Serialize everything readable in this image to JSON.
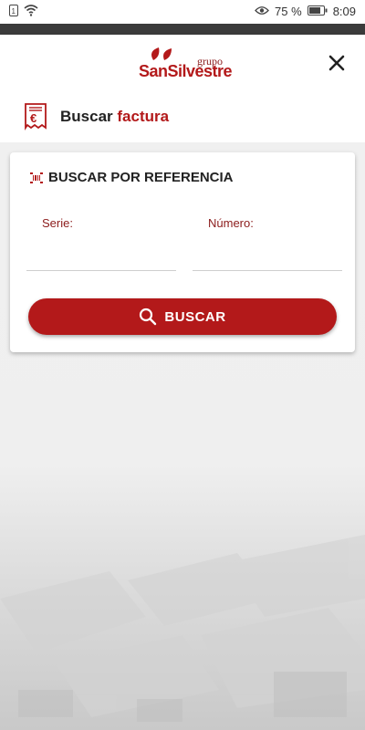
{
  "status_bar": {
    "battery_percent": "75 %",
    "time": "8:09"
  },
  "header": {
    "logo_small": "grupo",
    "logo_brand": "SanSilvestre"
  },
  "title": {
    "prefix": "Buscar",
    "accent": "factura"
  },
  "card": {
    "heading": "BUSCAR POR REFERENCIA",
    "serie_label": "Serie:",
    "numero_label": "Número:",
    "serie_value": "",
    "numero_value": "",
    "search_button": "BUSCAR"
  },
  "colors": {
    "brand_red": "#b3191a",
    "label_red": "#8b1b1b"
  },
  "icons": [
    "sim-icon",
    "wifi-icon",
    "eye-icon",
    "battery-icon",
    "close-icon",
    "invoice-euro-icon",
    "barcode-icon",
    "search-icon"
  ]
}
